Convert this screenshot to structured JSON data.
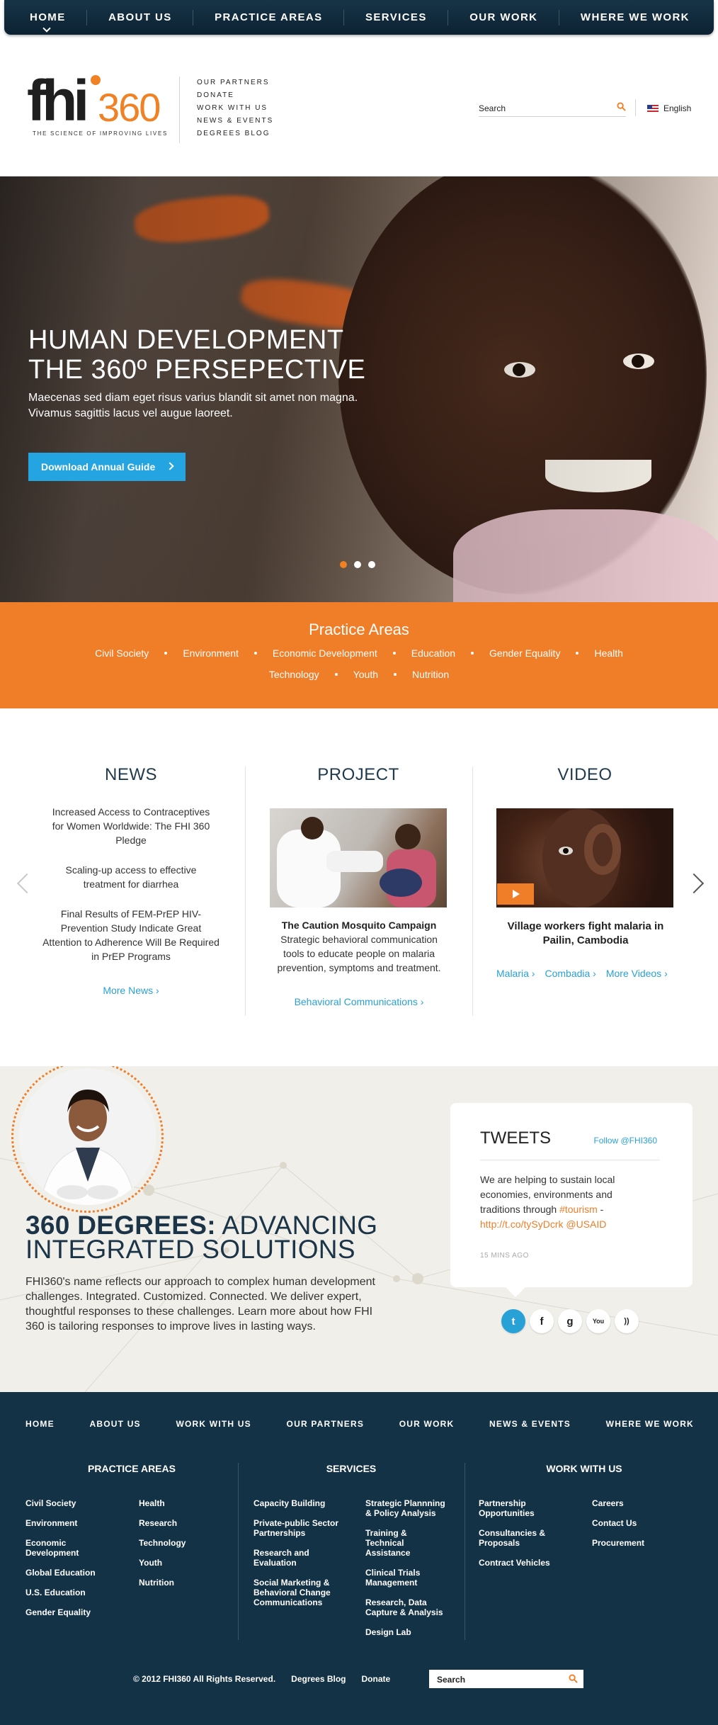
{
  "topnav": {
    "items": [
      "HOME",
      "ABOUT US",
      "PRACTICE AREAS",
      "SERVICES",
      "OUR WORK",
      "WHERE WE WORK"
    ]
  },
  "header": {
    "logo_text": "fhi360",
    "logo_fhi": "fhi",
    "logo_num": "360",
    "tagline": "THE SCIENCE OF IMPROVING LIVES",
    "utility_links": [
      "OUR PARTNERS",
      "DONATE",
      "WORK WITH US",
      "NEWS & EVENTS",
      "DEGREES BLOG"
    ],
    "search_placeholder": "Search",
    "language": "English"
  },
  "hero": {
    "title_line1": "HUMAN DEVELOPMENT",
    "title_line2": "THE 360º PERSEPECTIVE",
    "body": "Maecenas sed diam eget risus varius blandit sit amet non magna. Vivamus sagittis lacus vel augue laoreet.",
    "button_label": "Download Annual Guide",
    "slides": 3,
    "active_slide": 1
  },
  "practice_areas": {
    "title": "Practice Areas",
    "row1": [
      "Civil Society",
      "Environment",
      "Economic Development",
      "Education",
      "Gender Equality",
      "Health"
    ],
    "row2": [
      "Technology",
      "Youth",
      "Nutrition"
    ]
  },
  "news": {
    "title": "NEWS",
    "items": [
      "Increased Access to Contraceptives for Women Worldwide: The FHI 360 Pledge",
      "Scaling-up access to effective treatment for diarrhea",
      "Final Results of FEM-PrEP HIV-Prevention Study Indicate Great Attention to Adherence Will Be Required in PrEP Programs"
    ],
    "more": "More News ›"
  },
  "project": {
    "title": "PROJECT",
    "headline": "The Caution Mosquito Campaign",
    "body": "Strategic behavioral communication tools to educate people on malaria prevention, symptoms and treatment.",
    "link": "Behavioral Communications ›"
  },
  "video": {
    "title": "VIDEO",
    "headline": "Village workers fight malaria in Pailin, Cambodia",
    "links": [
      "Malaria ›",
      "Combadia ›",
      "More Videos ›"
    ]
  },
  "degrees": {
    "title_bold": "360 DEGREES:",
    "title_rest": " ADVANCING",
    "title_line2": "INTEGRATED SOLUTIONS",
    "body": "FHI360's name reflects our approach to complex human development challenges. Integrated. Customized. Connected. We deliver expert, thoughtful responses to these challenges. Learn more about how FHI 360 is tailoring responses to improve lives in lasting ways."
  },
  "tweets": {
    "title": "TWEETS",
    "follow": "Follow @FHI360",
    "text_before": "We are helping to sustain local economies, environments and traditions through ",
    "hashtag": "#tourism",
    "text_dash": " - ",
    "link": "http://t.co/tySyDcrk",
    "mention": " @USAID",
    "time": "15 MINS AGO",
    "social": [
      {
        "icon": "twitter-icon",
        "glyph": "t"
      },
      {
        "icon": "facebook-icon",
        "glyph": "f"
      },
      {
        "icon": "google-icon",
        "glyph": "g"
      },
      {
        "icon": "youtube-icon",
        "glyph": "You"
      },
      {
        "icon": "rss-icon",
        "glyph": "))"
      }
    ]
  },
  "footer": {
    "nav": [
      "HOME",
      "ABOUT US",
      "WORK WITH US",
      "OUR PARTNERS",
      "OUR WORK",
      "NEWS & EVENTS",
      "WHERE WE WORK"
    ],
    "practice_title": "PRACTICE AREAS",
    "practice_col1": [
      "Civil Society",
      "Environment",
      "Economic Development",
      "Global Education",
      "U.S. Education",
      "Gender Equality"
    ],
    "practice_col2": [
      "Health",
      "Research",
      "Technology",
      "Youth",
      "Nutrition"
    ],
    "services_title": "SERVICES",
    "services_col1": [
      "Capacity Building",
      "Private-public Sector Partnerships",
      "Research and Evaluation",
      "Social Marketing & Behavioral Change Communications"
    ],
    "services_col2": [
      "Strategic Plannning & Policy Analysis",
      "Training & Technical Assistance",
      "Clinical Trials Management",
      "Research, Data Capture & Analysis",
      "Design Lab"
    ],
    "work_title": "WORK WITH US",
    "work_col1": [
      "Partnership Opportunities",
      "Consultancies & Proposals",
      "Contract Vehicles"
    ],
    "work_col2": [
      "Careers",
      "Contact Us",
      "Procurement"
    ],
    "copyright": "© 2012 FHI360 All Rights Reserved.",
    "blog": "Degrees Blog",
    "donate": "Donate",
    "search_placeholder": "Search"
  },
  "colors": {
    "navy": "#133246",
    "orange": "#f07d28",
    "blue": "#24a4e0"
  }
}
